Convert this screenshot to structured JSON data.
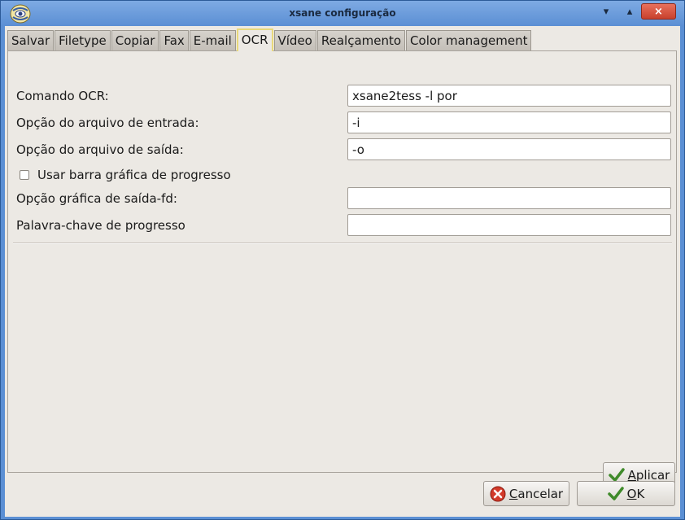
{
  "window": {
    "title": "xsane configuração",
    "close_glyph": "×",
    "min_glyph": "▾",
    "max_glyph": "▴"
  },
  "tabs": [
    {
      "label": "Salvar",
      "active": false
    },
    {
      "label": "Filetype",
      "active": false
    },
    {
      "label": "Copiar",
      "active": false
    },
    {
      "label": "Fax",
      "active": false
    },
    {
      "label": "E-mail",
      "active": false
    },
    {
      "label": "OCR",
      "active": true
    },
    {
      "label": "Vídeo",
      "active": false
    },
    {
      "label": "Realçamento",
      "active": false
    },
    {
      "label": "Color management",
      "active": false
    }
  ],
  "ocr": {
    "command_label": "Comando OCR:",
    "command_value": "xsane2tess -l por",
    "input_label": "Opção do arquivo de entrada:",
    "input_value": "-i",
    "output_label": "Opção do arquivo de saída:",
    "output_value": "-o",
    "progress_bar_label": "Usar barra gráfica de progresso",
    "progress_bar_checked": false,
    "gui_fd_label": "Opção gráfica de saída-fd:",
    "gui_fd_value": "",
    "progress_keyword_label": "Palavra-chave de progresso",
    "progress_keyword_value": ""
  },
  "buttons": {
    "apply_mnemonic": "A",
    "apply_rest": "plicar",
    "cancel_mnemonic": "C",
    "cancel_rest": "ancelar",
    "ok_mnemonic": "O",
    "ok_rest": "K"
  },
  "colors": {
    "titlebar": "#5b8fd4",
    "active_tab_border": "#e8d87a",
    "close_button": "#c8402c"
  },
  "icons": {
    "app": "xsane-app-icon",
    "apply": "checkmark-icon",
    "cancel": "cancel-icon",
    "ok": "checkmark-icon"
  }
}
